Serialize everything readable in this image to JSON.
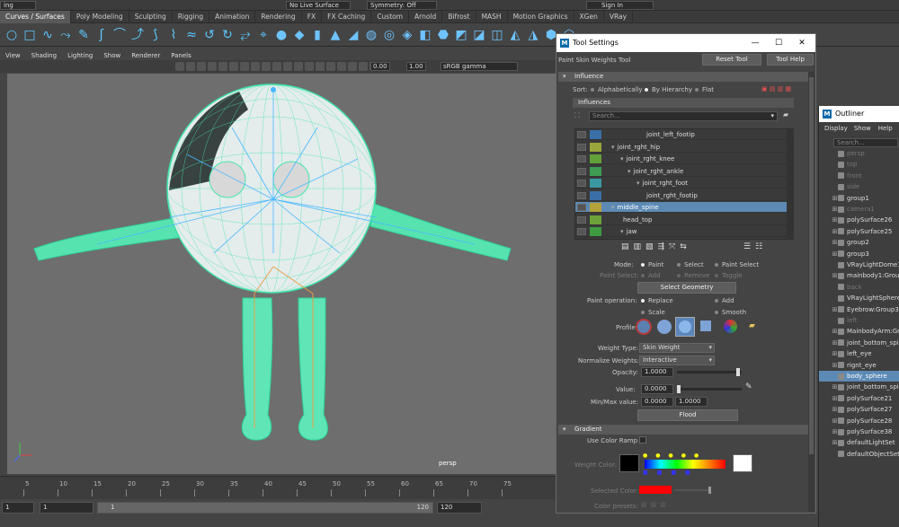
{
  "toprow": {
    "mode_combo": "ing",
    "live_surface": "No Live Surface",
    "symmetry": "Symmetry: Off",
    "sign_in": "Sign In"
  },
  "shelf_tabs": [
    "Curves / Surfaces",
    "Poly Modeling",
    "Sculpting",
    "Rigging",
    "Animation",
    "Rendering",
    "FX",
    "FX Caching",
    "Custom",
    "Arnold",
    "Bifrost",
    "MASH",
    "Motion Graphics",
    "XGen",
    "VRay"
  ],
  "shelf_active": "Curves / Surfaces",
  "panel_menus": [
    "View",
    "Shading",
    "Lighting",
    "Show",
    "Renderer",
    "Panels"
  ],
  "panel_fields": {
    "exposure": "0.00",
    "gamma": "1.00",
    "color_space": "sRGB gamma"
  },
  "viewport": {
    "camera": "persp"
  },
  "timeline": {
    "ticks": [
      "5",
      "10",
      "15",
      "20",
      "25",
      "30",
      "35",
      "40",
      "45",
      "50",
      "55",
      "60",
      "65",
      "70",
      "75"
    ]
  },
  "range": {
    "start": "1",
    "current": "1",
    "range_start": "1",
    "range_end": "120",
    "end": "120"
  },
  "tool_settings": {
    "title": "Tool Settings",
    "tool_name": "Paint Skin Weights Tool",
    "reset_tool": "Reset Tool",
    "tool_help": "Tool Help",
    "influence_section": "Influence",
    "sort_label": "Sort:",
    "sort_options": [
      "Alphabetically",
      "By Hierarchy",
      "Flat"
    ],
    "influences_header": "Influences",
    "search_placeholder": "Search...",
    "influences": [
      {
        "name": "joint_left_footip",
        "color": "#3a6fa8",
        "indent": 84,
        "arrow": ""
      },
      {
        "name": "joint_rght_hip",
        "color": "#9aa53b",
        "indent": 48,
        "arrow": "▾"
      },
      {
        "name": "joint_rght_knee",
        "color": "#62a03a",
        "indent": 58,
        "arrow": "▾"
      },
      {
        "name": "joint_rght_ankle",
        "color": "#3e9b52",
        "indent": 66,
        "arrow": "▾"
      },
      {
        "name": "joint_rght_foot",
        "color": "#3a98a0",
        "indent": 76,
        "arrow": "▾"
      },
      {
        "name": "joint_rght_footip",
        "color": "#3a6fa8",
        "indent": 84,
        "arrow": ""
      },
      {
        "name": "middle_spine",
        "color": "#b3a23a",
        "indent": 48,
        "arrow": "▾",
        "selected": true
      },
      {
        "name": "head_top",
        "color": "#6da23a",
        "indent": 58,
        "arrow": ""
      },
      {
        "name": "jaw",
        "color": "#3f9b3f",
        "indent": 58,
        "arrow": "▾"
      }
    ],
    "mode_label": "Mode:",
    "mode_options": [
      "Paint",
      "Select",
      "Paint Select"
    ],
    "paint_select_label": "Paint Select:",
    "paint_select_options": [
      "Add",
      "Remove",
      "Toggle"
    ],
    "select_geometry": "Select Geometry",
    "paint_op_label": "Paint operation:",
    "paint_ops": [
      "Replace",
      "Add",
      "Scale",
      "Smooth"
    ],
    "profile_label": "Profile:",
    "weight_type_label": "Weight Type:",
    "weight_type": "Skin Weight",
    "normalize_label": "Normalize Weights:",
    "normalize": "Interactive",
    "opacity_label": "Opacity:",
    "opacity": "1.0000",
    "value_label": "Value:",
    "value": "0.0000",
    "minmax_label": "Min/Max value:",
    "min": "0.0000",
    "max": "1.0000",
    "flood": "Flood",
    "gradient_section": "Gradient",
    "use_color_ramp": "Use Color Ramp",
    "weight_color_label": "Weight Color:",
    "selected_color_label": "Selected Color:",
    "selected_color": "#ff0000",
    "color_presets_label": "Color presets:"
  },
  "outliner": {
    "title": "Outliner",
    "menus": [
      "Display",
      "Show",
      "Help"
    ],
    "search_placeholder": "Search...",
    "items": [
      {
        "name": "persp",
        "dim": true,
        "plus": false
      },
      {
        "name": "top",
        "dim": true,
        "plus": false
      },
      {
        "name": "front",
        "dim": true,
        "plus": false
      },
      {
        "name": "side",
        "dim": true,
        "plus": false
      },
      {
        "name": "group1",
        "dim": false,
        "plus": true
      },
      {
        "name": "camera1",
        "dim": true,
        "plus": true
      },
      {
        "name": "polySurface26",
        "dim": false,
        "plus": true
      },
      {
        "name": "polySurface25",
        "dim": false,
        "plus": true
      },
      {
        "name": "group2",
        "dim": false,
        "plus": true
      },
      {
        "name": "group3",
        "dim": false,
        "plus": true
      },
      {
        "name": "VRayLightDome1",
        "dim": false,
        "plus": false
      },
      {
        "name": "mainbody1:Group",
        "dim": false,
        "plus": true
      },
      {
        "name": "back",
        "dim": true,
        "plus": false
      },
      {
        "name": "VRayLightSphere",
        "dim": false,
        "plus": false
      },
      {
        "name": "Eyebrow:Group3",
        "dim": false,
        "plus": true
      },
      {
        "name": "left",
        "dim": true,
        "plus": false
      },
      {
        "name": "MainbodyArm:Gr",
        "dim": false,
        "plus": true
      },
      {
        "name": "joint_bottom_spi",
        "dim": false,
        "plus": true
      },
      {
        "name": "left_eye",
        "dim": false,
        "plus": true
      },
      {
        "name": "rignt_eye",
        "dim": false,
        "plus": true
      },
      {
        "name": "body_sphere",
        "dim": false,
        "plus": false,
        "selected": true
      },
      {
        "name": "joint_bottom_spi",
        "dim": false,
        "plus": true
      },
      {
        "name": "polySurface21",
        "dim": false,
        "plus": true
      },
      {
        "name": "polySurface27",
        "dim": false,
        "plus": true
      },
      {
        "name": "polySurface28",
        "dim": false,
        "plus": true
      },
      {
        "name": "polySurface38",
        "dim": false,
        "plus": true
      },
      {
        "name": "defaultLightSet",
        "dim": false,
        "plus": true
      },
      {
        "name": "defaultObjectSet",
        "dim": false,
        "plus": false
      }
    ]
  }
}
